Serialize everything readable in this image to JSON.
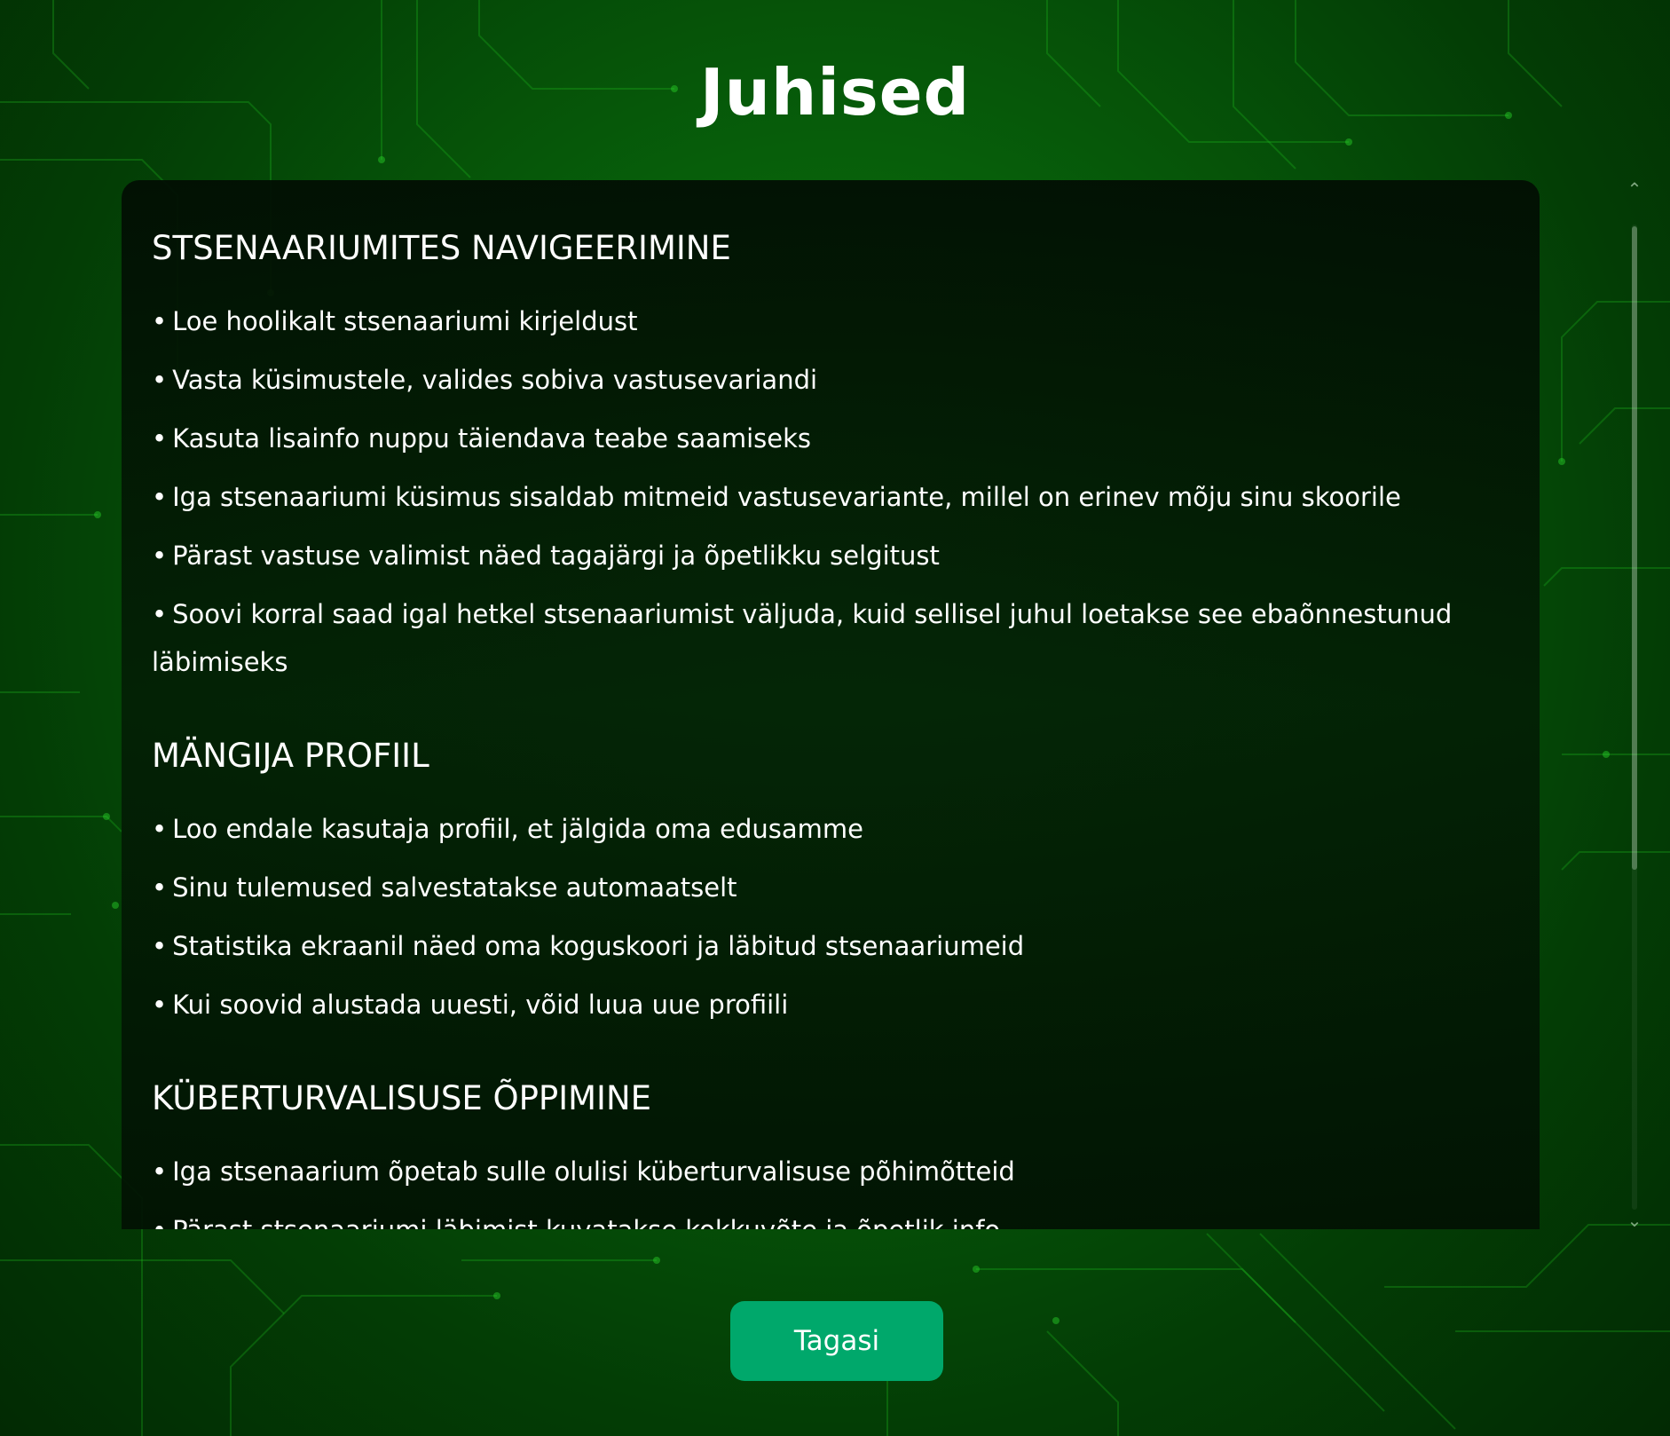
{
  "title": "Juhised",
  "sections": [
    {
      "heading": "STSENAARIUMITES NAVIGEERIMINE",
      "items": [
        "Loe hoolikalt stsenaariumi kirjeldust",
        "Vasta küsimustele, valides sobiva vastusevariandi",
        "Kasuta lisainfo nuppu täiendava teabe saamiseks",
        "Iga stsenaariumi küsimus sisaldab mitmeid vastusevariante, millel on erinev mõju sinu skoorile",
        "Pärast vastuse valimist näed tagajärgi ja õpetlikku selgitust",
        "Soovi korral saad igal hetkel stsenaariumist väljuda, kuid sellisel juhul loetakse see ebaõnnestunud läbimiseks"
      ]
    },
    {
      "heading": "MÄNGIJA PROFIIL",
      "items": [
        "Loo endale kasutaja profiil, et jälgida oma edusamme",
        "Sinu tulemused salvestatakse automaatselt",
        "Statistika ekraanil näed oma koguskoori ja läbitud stsenaariumeid",
        "Kui soovid alustada uuesti, võid luua uue profiili"
      ]
    },
    {
      "heading": "KÜBERTURVALISUSE ÕPPIMINE",
      "items": [
        "Iga stsenaarium õpetab sulle olulisi küberturvalisuse põhimõtteid",
        "Pärast stsenaariumi läbimist kuvatakse kokkuvõte ja õpetlik info"
      ]
    }
  ],
  "bullet": "•",
  "scrollbar": {
    "up_icon": "chevron-up-icon",
    "down_icon": "chevron-down-icon",
    "up_glyph": "⌃",
    "down_glyph": "⌄"
  },
  "back_button": {
    "label": "Tagasi"
  },
  "colors": {
    "background": "#075e0a",
    "panel": "#021203",
    "button": "#00a86b",
    "text": "#ffffff"
  }
}
